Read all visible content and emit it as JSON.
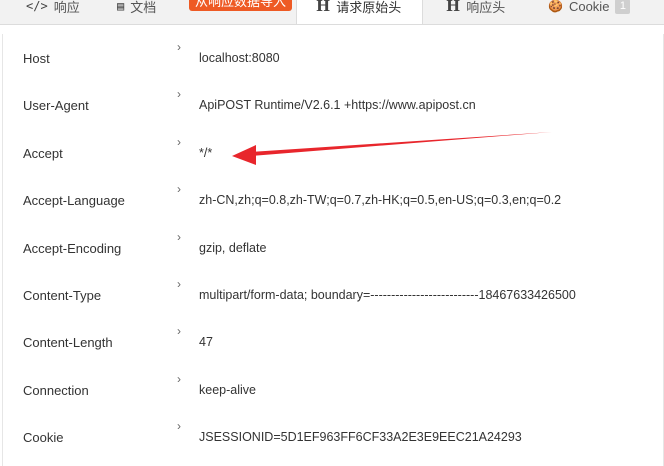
{
  "tabs": [
    {
      "icon": "code-icon",
      "glyph": "</>",
      "label": "响应"
    },
    {
      "icon": "document-icon",
      "glyph": "▤",
      "label": "文档"
    },
    {
      "label": "从响应数据导入"
    },
    {
      "icon": "header-icon",
      "glyph": "H",
      "label": "请求原始头"
    },
    {
      "icon": "header-icon",
      "glyph": "H",
      "label": "响应头"
    },
    {
      "icon": "cookie-icon",
      "glyph": "🍪",
      "label": "Cookie",
      "badge": "1"
    }
  ],
  "colors": {
    "highlight": "#ee5a24",
    "arrow": "#e8262c"
  },
  "headers": [
    {
      "key": "Host",
      "value": "localhost:8080"
    },
    {
      "key": "User-Agent",
      "value": "ApiPOST Runtime/V2.6.1 +https://www.apipost.cn"
    },
    {
      "key": "Accept",
      "value": "*/*"
    },
    {
      "key": "Accept-Language",
      "value": "zh-CN,zh;q=0.8,zh-TW;q=0.7,zh-HK;q=0.5,en-US;q=0.3,en;q=0.2"
    },
    {
      "key": "Accept-Encoding",
      "value": "gzip, deflate"
    },
    {
      "key": "Content-Type",
      "value": "multipart/form-data; boundary=--------------------------18467633426500"
    },
    {
      "key": "Content-Length",
      "value": "47"
    },
    {
      "key": "Connection",
      "value": "keep-alive"
    },
    {
      "key": "Cookie",
      "value": "JSESSIONID=5D1EF963FF6CF33A2E3E9EEC21A24293"
    }
  ],
  "chevron": "›"
}
